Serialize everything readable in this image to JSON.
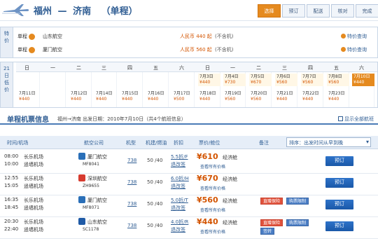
{
  "header": {
    "origin": "福州",
    "separator": "—",
    "destination": "济南",
    "trip_type": "（单程）"
  },
  "steps": [
    {
      "label": "选择",
      "active": true
    },
    {
      "label": "预订",
      "active": false
    },
    {
      "label": "配送",
      "active": false
    },
    {
      "label": "核对",
      "active": false
    },
    {
      "label": "完成",
      "active": false
    }
  ],
  "promo": {
    "side_label": "特价",
    "rows": [
      {
        "type_label": "单程",
        "airline": "山东航空",
        "desc": "",
        "price": "人民币 440 起",
        "note": "(不含机)",
        "link": "特价查询"
      },
      {
        "type_label": "单程",
        "airline": "厦门航空",
        "desc": "",
        "price": "人民币 560 起",
        "note": "(不含机)",
        "link": "特价查询"
      }
    ]
  },
  "calendar": {
    "side_label": "21日低价",
    "weekdays": [
      "日",
      "一",
      "二",
      "三",
      "四",
      "五",
      "六",
      "日",
      "一",
      "二",
      "三",
      "四",
      "五",
      "六"
    ],
    "cells": [
      {
        "col": 7,
        "row": 0,
        "date": "7月3日",
        "price": "¥440"
      },
      {
        "col": 8,
        "row": 0,
        "date": "7月4日",
        "price": "¥730"
      },
      {
        "col": 9,
        "row": 0,
        "date": "7月5日",
        "price": "¥670"
      },
      {
        "col": 10,
        "row": 0,
        "date": "7月6日",
        "price": "¥560"
      },
      {
        "col": 11,
        "row": 0,
        "date": "7月7日",
        "price": "¥560"
      },
      {
        "col": 12,
        "row": 0,
        "date": "7月8日",
        "price": "¥560"
      },
      {
        "col": 13,
        "row": 0,
        "date": "7月10日",
        "price": "¥440",
        "selected": true
      },
      {
        "col": 0,
        "row": 1,
        "date": "7月11日",
        "price": "¥440"
      },
      {
        "col": 2,
        "row": 1,
        "date": "7月12日",
        "price": "¥440"
      },
      {
        "col": 4,
        "row": 1,
        "date": "7月15日",
        "price": "¥440"
      },
      {
        "col": 3,
        "row": 1,
        "date": "7月14日",
        "price": "¥440"
      },
      {
        "col": 5,
        "row": 1,
        "date": "7月16日",
        "price": "¥440"
      },
      {
        "col": 6,
        "row": 1,
        "date": "7月17日",
        "price": "¥500"
      },
      {
        "col": 7,
        "row": 1,
        "date": "7月18日",
        "price": "¥440"
      },
      {
        "col": 8,
        "row": 1,
        "date": "7月19日",
        "price": "¥560"
      },
      {
        "col": 9,
        "row": 1,
        "date": "7月20日",
        "price": "¥560"
      },
      {
        "col": 10,
        "row": 1,
        "date": "7月21日",
        "price": "¥440"
      },
      {
        "col": 11,
        "row": 1,
        "date": "7月22日",
        "price": "¥440"
      },
      {
        "col": 12,
        "row": 1,
        "date": "7月23日",
        "price": "¥440"
      }
    ]
  },
  "list": {
    "title": "单程机票信息",
    "subtitle": "福州→济南  出发日期：2010年7月10日（共4个航班信息）",
    "right_link": "显示全部航班",
    "headers": [
      "时间/机场",
      "航空公司",
      "机型",
      "机建/燃油",
      "折扣",
      "票价/舱位",
      "备注"
    ],
    "sort_label": "排序：出发时间从早到晚",
    "flights": [
      {
        "dep_time": "08:00",
        "arr_time": "10:00",
        "dep_apt": "长乐机场",
        "arr_apt": "遥墙机场",
        "airline": "厦门航空",
        "flight_no": "MF8041",
        "logo_color": "#2a6fb8",
        "model": "738",
        "fee": "50 /40",
        "discount": "5.5折/F",
        "policy": "退改签",
        "price": "¥610",
        "cabin": "经济舱",
        "more": "查看所有价格",
        "tags": [],
        "book": "预订"
      },
      {
        "dep_time": "12:55",
        "arr_time": "15:05",
        "dep_apt": "长乐机场",
        "arr_apt": "遥墙机场",
        "airline": "深圳航空",
        "flight_no": "ZH9655",
        "logo_color": "#d63b2f",
        "model": "738",
        "fee": "50 /40",
        "discount": "6.0折/H",
        "policy": "退改签",
        "price": "¥670",
        "cabin": "经济舱",
        "more": "查看所有价格",
        "tags": [],
        "book": "预订"
      },
      {
        "dep_time": "16:35",
        "arr_time": "18:45",
        "dep_apt": "长乐机场",
        "arr_apt": "遥墙机场",
        "airline": "厦门航空",
        "flight_no": "MF8071",
        "logo_color": "#2a6fb8",
        "model": "738",
        "fee": "50 /40",
        "discount": "5.0折/T",
        "policy": "退改签",
        "price": "¥560",
        "cabin": "经济舱",
        "more": "查看所有价格",
        "tags": [
          {
            "label": "直赠保险",
            "color": "red"
          },
          {
            "label": "购票限制",
            "color": "blue"
          }
        ],
        "book": "预订"
      },
      {
        "dep_time": "20:30",
        "arr_time": "22:40",
        "dep_apt": "长乐机场",
        "arr_apt": "遥墙机场",
        "airline": "山东航空",
        "flight_no": "SC1178",
        "logo_color": "#1f5aa6",
        "model": "738",
        "fee": "50 /40",
        "discount": "4.0折/R",
        "policy": "退改签",
        "price": "¥440",
        "cabin": "经济舱",
        "more": "查看所有价格",
        "tags": [
          {
            "label": "直赠保险",
            "color": "red"
          },
          {
            "label": "购票限制",
            "color": "blue"
          },
          {
            "label": "签转",
            "color": "blue"
          }
        ],
        "book": "预订"
      }
    ]
  }
}
